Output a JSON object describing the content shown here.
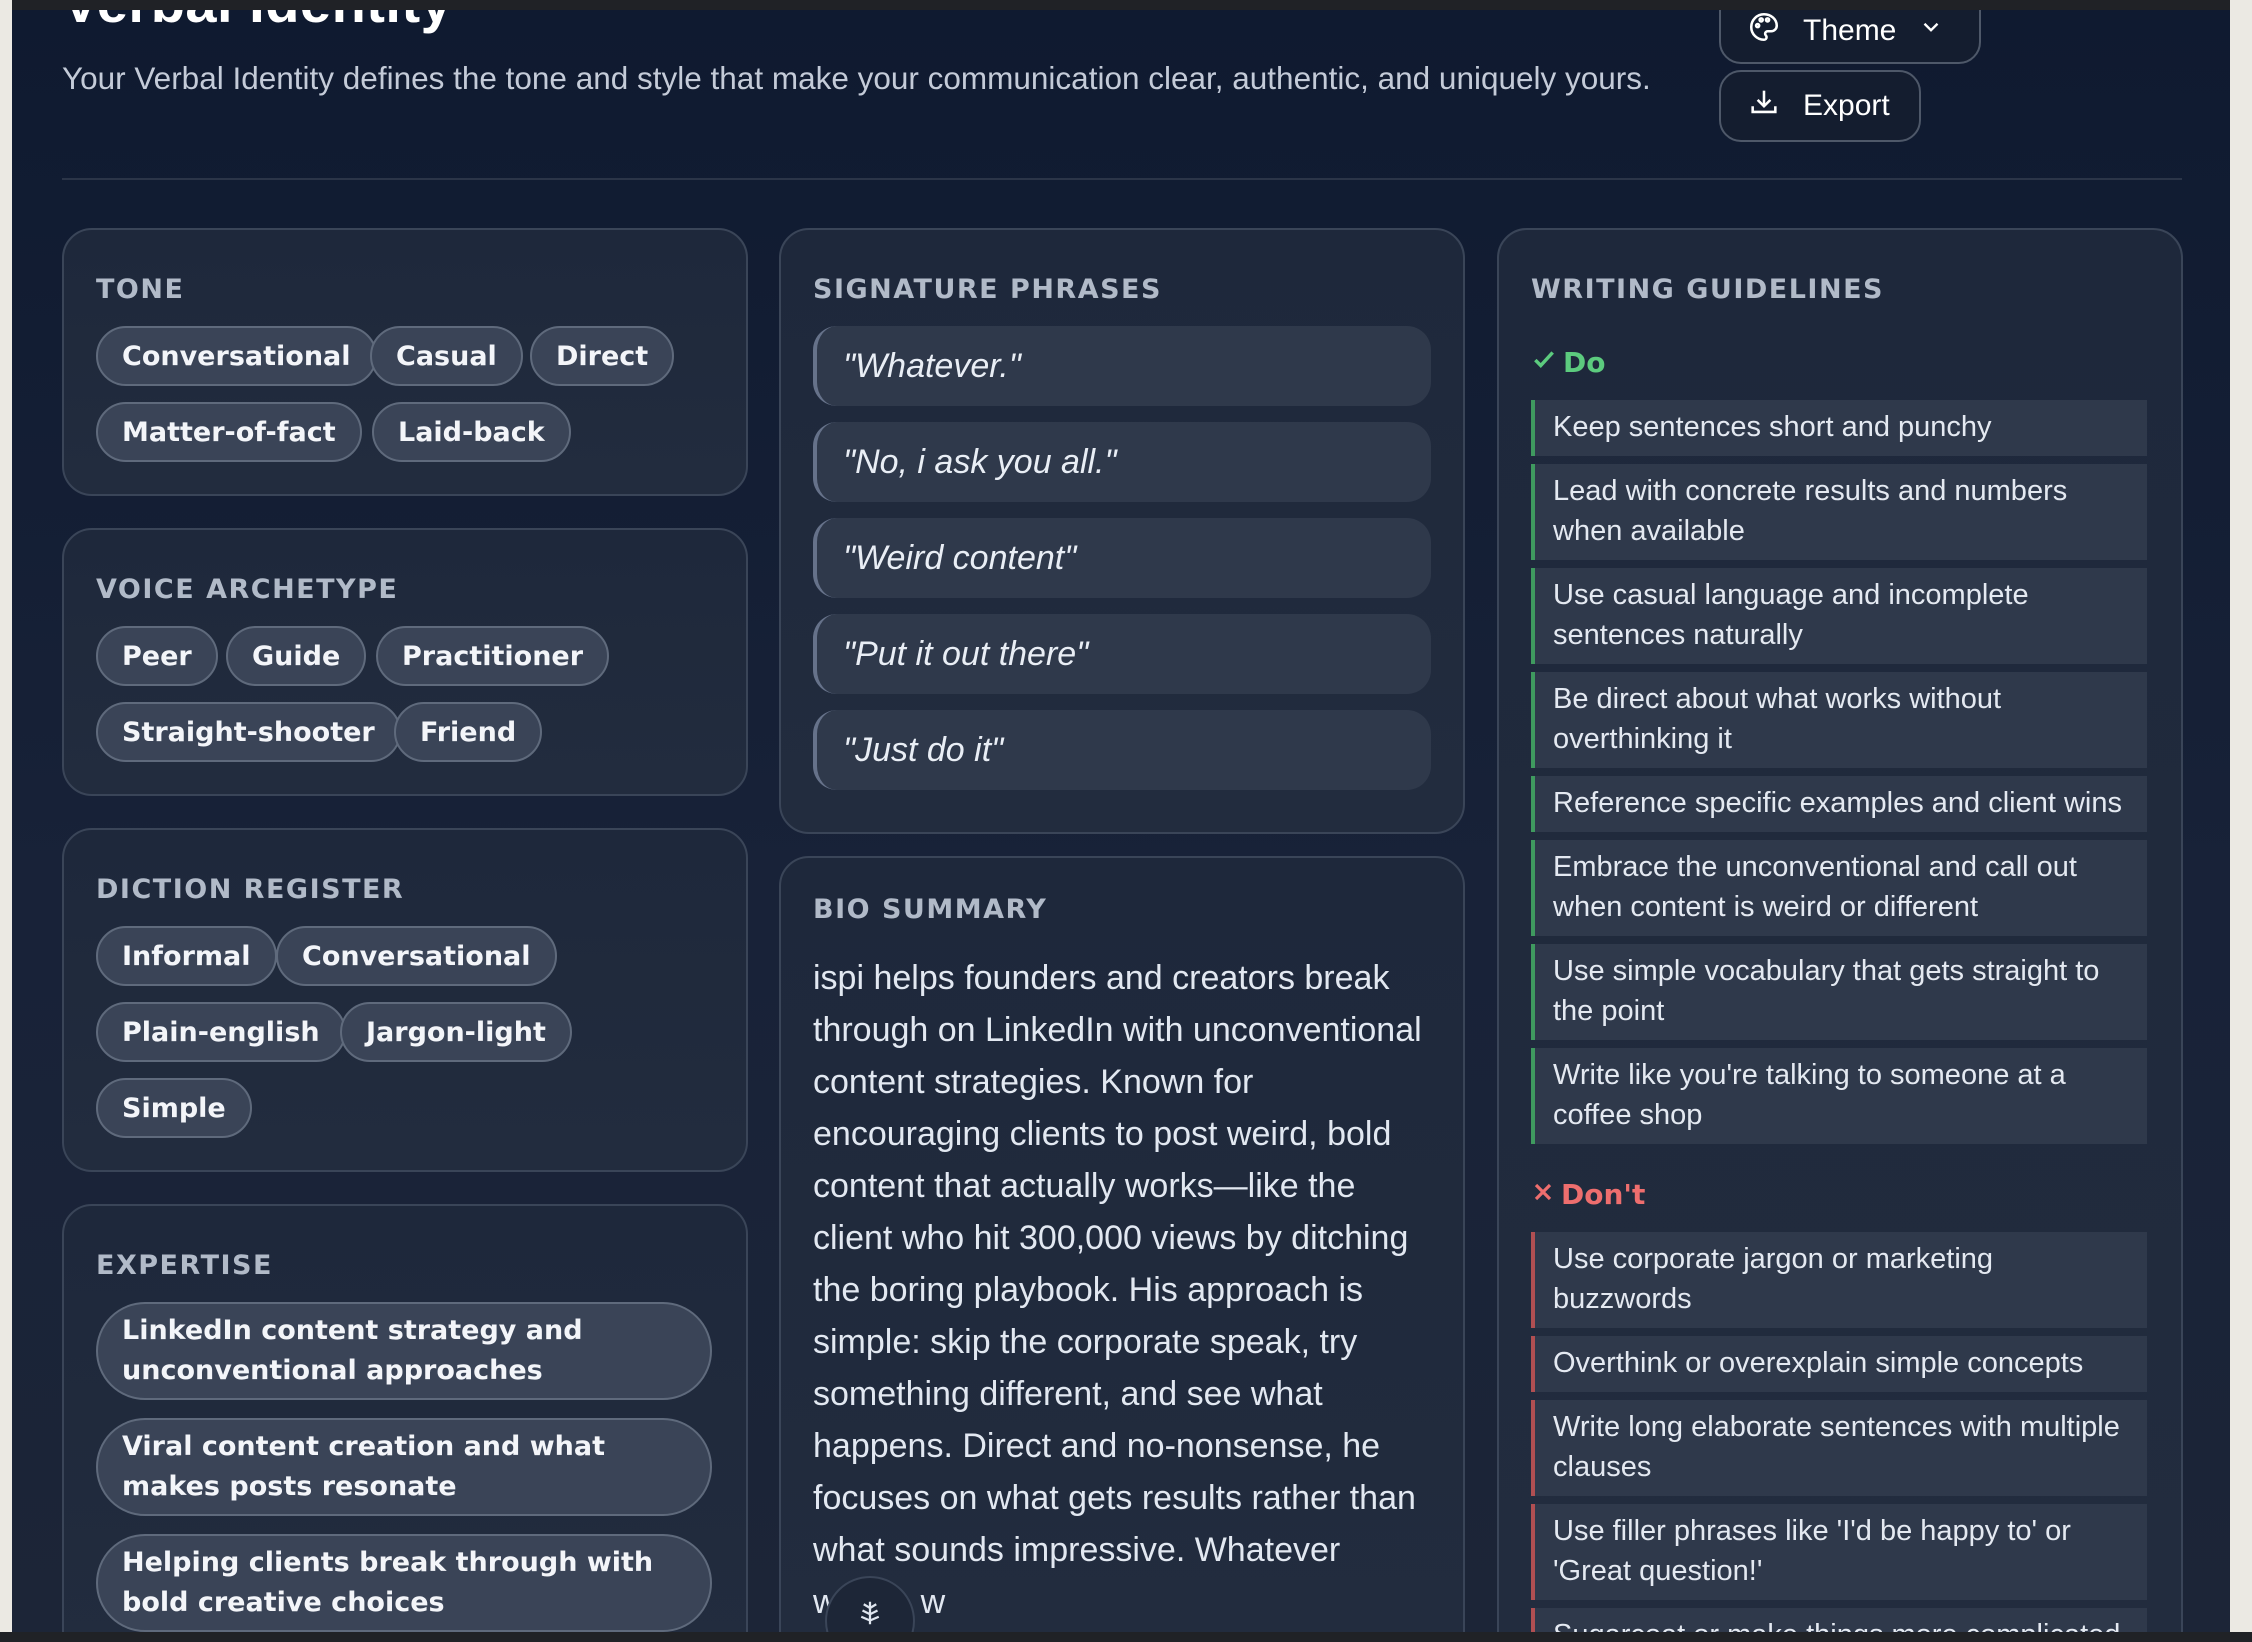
{
  "header": {
    "title": "Verbal Identity",
    "description": "Your Verbal Identity defines the tone and style that make your communication clear, authentic, and uniquely yours.",
    "theme_label": "Theme",
    "export_label": "Export"
  },
  "tone": {
    "title": "TONE",
    "items": [
      "Conversational",
      "Casual",
      "Direct",
      "Matter-of-fact",
      "Laid-back"
    ]
  },
  "voice_archetype": {
    "title": "VOICE ARCHETYPE",
    "items": [
      "Peer",
      "Guide",
      "Practitioner",
      "Straight-shooter",
      "Friend"
    ]
  },
  "diction_register": {
    "title": "DICTION REGISTER",
    "items": [
      "Informal",
      "Conversational",
      "Plain-english",
      "Jargon-light",
      "Simple"
    ]
  },
  "expertise": {
    "title": "EXPERTISE",
    "items": [
      "LinkedIn content strategy and unconventional approaches",
      "Viral content creation and what makes posts resonate",
      "Helping clients break through with bold creative choices"
    ]
  },
  "signature_phrases": {
    "title": "SIGNATURE PHRASES",
    "items": [
      "\"Whatever.\"",
      "\"No, i ask you all.\"",
      "\"Weird content\"",
      "\"Put it out there\"",
      "\"Just do it\""
    ]
  },
  "bio_summary": {
    "title": "BIO SUMMARY",
    "text": "ispi helps founders and creators break through on LinkedIn with unconventional content strategies. Known for encouraging clients to post weird, bold content that actually works—like the client who hit 300,000 views by ditching the boring playbook. His approach is simple: skip the corporate speak, try something different, and see what happens. Direct and no-nonsense, he focuses on what gets results rather than what sounds impressive. Whatever works, w"
  },
  "writing_guidelines": {
    "title": "WRITING GUIDELINES",
    "do_label": "Do",
    "dont_label": "Don't",
    "do": [
      "Keep sentences short and punchy",
      "Lead with concrete results and numbers when available",
      "Use casual language and incomplete sentences naturally",
      "Be direct about what works without overthinking it",
      "Reference specific examples and client wins",
      "Embrace the unconventional and call out when content is weird or different",
      "Use simple vocabulary that gets straight to the point",
      "Write like you're talking to someone at a coffee shop"
    ],
    "dont": [
      "Use corporate jargon or marketing buzzwords",
      "Overthink or overexplain simple concepts",
      "Write long elaborate sentences with multiple clauses",
      "Use filler phrases like 'I'd be happy to' or 'Great question!'",
      "Sugarcoat or make things more complicated"
    ]
  },
  "colors": {
    "background": "#131a2a",
    "card": "#1f293c",
    "pill": "#3a4457",
    "do_accent": "#5ccb7e",
    "dont_accent": "#ee6e6e"
  },
  "icons": [
    "palette-icon",
    "chevron-down-icon",
    "download-icon",
    "check-icon",
    "x-icon",
    "assistant-icon"
  ]
}
